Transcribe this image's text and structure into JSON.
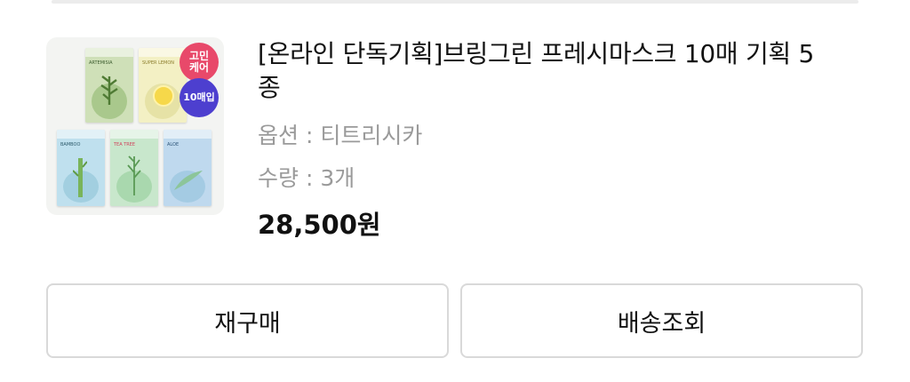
{
  "order_item": {
    "title": "[온라인 단독기획]브링그린 프레시마스크 10매 기획 5종",
    "option_label": "옵션",
    "option_value": "티트리시카",
    "quantity_label": "수량",
    "quantity_value": "3개",
    "price": "28,500원",
    "thumbnail": {
      "badge_top": "고민\n케어",
      "badge_bottom": "10매입",
      "packs": [
        "ARTEMISIA",
        "SUPER LEMON",
        "BAMBOO",
        "TEA TREE",
        "ALOE"
      ],
      "colors": {
        "badge_pink": "#e8496a",
        "badge_purple": "#4d3fcf"
      }
    }
  },
  "actions": {
    "reorder_label": "재구매",
    "tracking_label": "배송조회"
  }
}
